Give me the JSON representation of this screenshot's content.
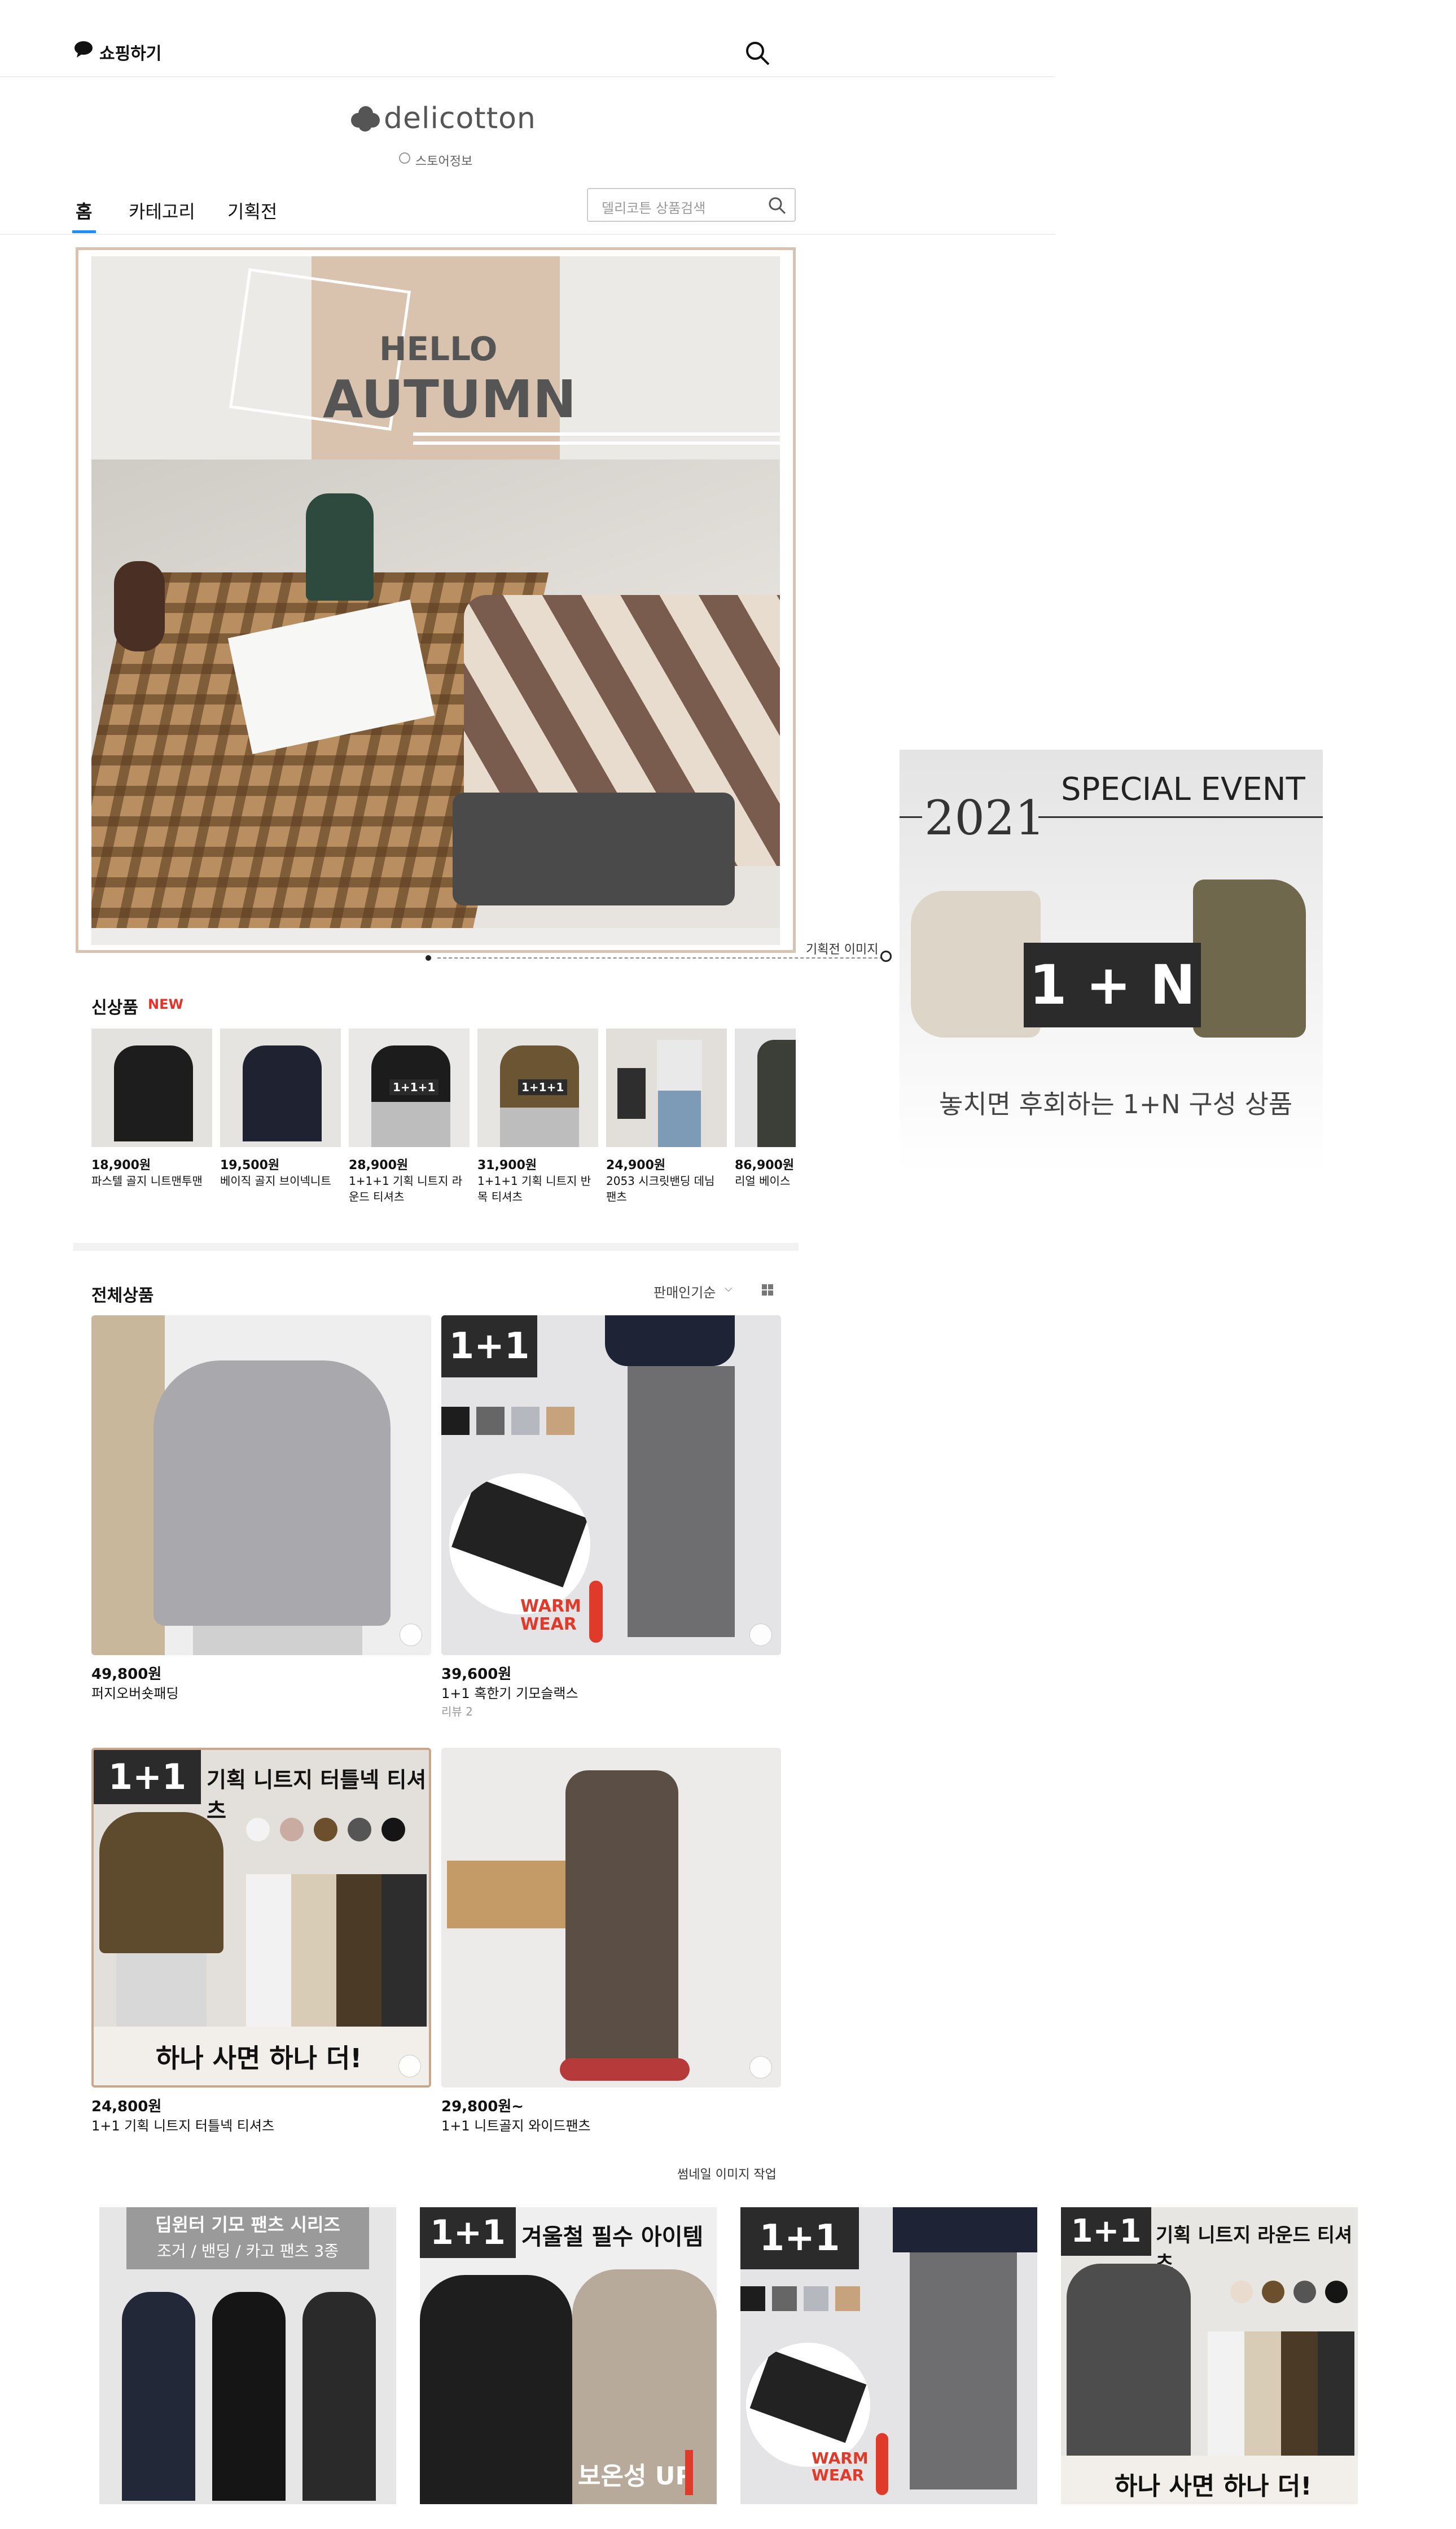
{
  "top": {
    "shop_label": "쇼핑하기"
  },
  "store": {
    "logo": "delicotton",
    "info": "스토어정보"
  },
  "nav": {
    "home": "홈",
    "category": "카테고리",
    "promo": "기획전"
  },
  "search": {
    "placeholder": "델리코튼 상품검색"
  },
  "banner": {
    "line1": "HELLO",
    "line2": "AUTUMN",
    "annotation": "기획전 이미지"
  },
  "new_products": {
    "title": "신상품",
    "badge": "NEW",
    "items": [
      {
        "price": "18,900원",
        "name": "파스텔 골지 니트맨투맨",
        "tag": ""
      },
      {
        "price": "19,500원",
        "name": "베이직 골지 브이넥니트",
        "tag": ""
      },
      {
        "price": "28,900원",
        "name": "1+1+1 기획 니트지 라운드 티셔츠",
        "tag": "1+1+1"
      },
      {
        "price": "31,900원",
        "name": "1+1+1 기획 니트지 반목 티셔츠",
        "tag": "1+1+1"
      },
      {
        "price": "24,900원",
        "name": "2053 시크릿밴딩 데님팬츠",
        "tag": ""
      },
      {
        "price": "86,900원",
        "name": "리얼 베이스",
        "tag": ""
      }
    ]
  },
  "all_products": {
    "title": "전체상품",
    "sort": "판매인기순",
    "items": [
      {
        "price": "49,800원",
        "name": "퍼지오버숏패딩",
        "review": ""
      },
      {
        "price": "39,600원",
        "name": "1+1 혹한기 기모슬랙스",
        "review": "리뷰 2"
      },
      {
        "price": "24,800원",
        "name": "1+1 기획 니트지 터틀넥 티셔츠",
        "review": ""
      },
      {
        "price": "29,800원~",
        "name": "1+1 니트골지 와이드팬츠",
        "review": ""
      }
    ],
    "overlays": {
      "onepone": "1+1",
      "warm1": "WARM",
      "warm2": "WEAR",
      "turtle_caption": "기획 니트지 터틀넥 티셔츠",
      "turtle_bottom": "하나 사면 하나 더!"
    }
  },
  "thumbnails": {
    "label": "썸네일 이미지 작업",
    "t1_line1": "딥윈터 기모 팬츠 시리즈",
    "t1_line2": "조거 / 밴딩 / 카고 팬츠 3종",
    "t2_caption": "겨울철 필수 아이템",
    "t2_bottom": "보온성 UP",
    "t4_caption": "기획 니트지 라운드 티셔츠",
    "t4_bottom": "하나 사면 하나 더!",
    "onepone": "1+1",
    "warm1": "WARM",
    "warm2": "WEAR"
  },
  "event": {
    "year": "2021",
    "title": "SPECIAL EVENT",
    "badge": "1 + N",
    "caption": "놓치면 후회하는 1+N 구성 상품"
  },
  "colors": {
    "accent_blue": "#1c8cff",
    "new_red": "#e3332b",
    "banner_tan": "#d9c3ae",
    "frame": "#d8c3b3"
  }
}
